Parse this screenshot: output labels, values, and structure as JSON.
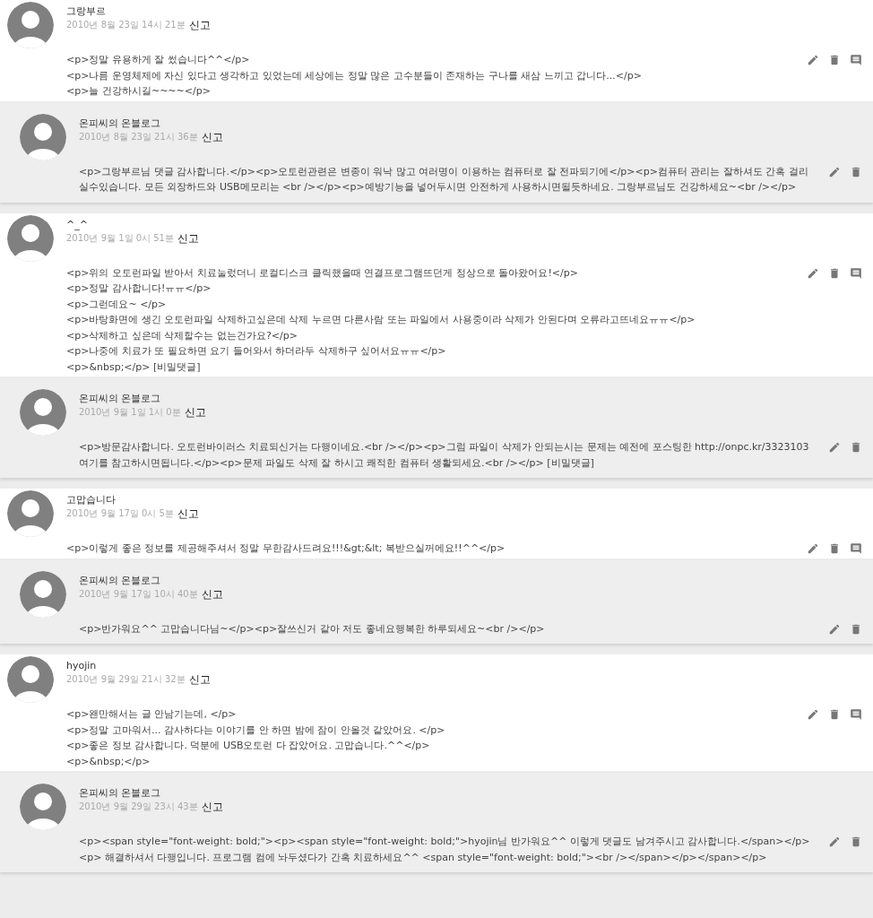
{
  "comments": [
    {
      "author": "그랑부르",
      "date": "2010년 8월 23일 14시 21분",
      "report": "신고",
      "lines": [
        "<p>정말 유용하게 잘 썼습니다^^</p>",
        "<p>나름 운영체제에 자신 있다고 생각하고 있었는데 세상에는 정말 많은 고수분들이 존재하는 구나를 새삼 느끼고 갑니다...</p>",
        "<p>늘 건강하시길~~~~</p>"
      ],
      "replies": [
        {
          "author": "온피씨의 온블로그",
          "date": "2010년 8월 23일 21시 36분",
          "report": "신고",
          "text": "<p>그랑부르님 댓글 감사합니다.</p><p>오토런관련은 변종이 워낙 많고 여러명이 이용하는 컴퓨터로 잘 전파되기에</p><p>컴퓨터 관리는 잘하셔도 간혹 걸리실수있습니다. 모든 외장하드와 USB메모리는 <br /></p><p>예방기능을 넣어두시면 안전하게 사용하시면될듯하네요. 그랑부르님도 건강하세요~<br /></p>"
        }
      ]
    },
    {
      "author": "^_^",
      "date": "2010년 9월 1일 0시 51분",
      "report": "신고",
      "lines": [
        "<p>위의 오토런파일 받아서 치료눌렀더니 로컬디스크 클릭했을때 연결프로그램뜨던게 정상으로 돌아왔어요!</p>",
        "<p>정말 감사합니다!ㅠㅠ</p>",
        "<p>그런데요~ </p>",
        "<p>바탕화면에 생긴 오토런파일 삭제하고싶은데 삭제 누르면 다른사람 또는 파일에서 사용중이라 삭제가 안된다며 오류라고뜨네요ㅠㅠ</p>",
        "<p>삭제하고 싶은데 삭제할수는 없는건가요?</p>",
        "<p>나중에 치료가 또 필요하면 요기 들어와서 하더라두 삭제하구 싶어서요ㅠㅠ</p>",
        "<p>&nbsp;</p> [비밀댓글]"
      ],
      "replies": [
        {
          "author": "온피씨의 온블로그",
          "date": "2010년 9월 1일 1시 0분",
          "report": "신고",
          "text": "<p>방문감사합니다. 오토런바이러스 치료되신거는 다행이네요.<br /></p><p>그럼 파일이 삭제가 안되는시는 문제는 예전에 포스팅한 http://onpc.kr/3323103 여기를 참고하시면됩니다.</p><p>문제 파일도 삭제 잘 하시고 쾌적한 컴퓨터 생활되세요.<br /></p> [비밀댓글]"
        }
      ]
    },
    {
      "author": "고맙습니다",
      "date": "2010년 9월 17일 0시 5분",
      "report": "신고",
      "lines": [
        "<p>이렇게 좋은 정보를 제공해주셔서 정말 무한감사드려요!!!&gt;&lt; 복받으실꺼에요!!^^</p>"
      ],
      "replies": [
        {
          "author": "온피씨의 온블로그",
          "date": "2010년 9월 17일 10시 40분",
          "report": "신고",
          "text": "<p>반가워요^^ 고맙습니다님~</p><p>잘쓰신거 같아 저도 좋네요행복한 하루되세요~<br /></p>"
        }
      ]
    },
    {
      "author": "hyojin",
      "date": "2010년 9월 29일 21시 32분",
      "report": "신고",
      "lines": [
        "<p>왠만해서는 글 안남기는데, </p>",
        "<p>정말 고마워서... 감사하다는 이야기를 안 하면 밤에 잠이 안올것 같았어요. </p>",
        "<p>좋은 정보 감사합니다. 덕분에 USB오토런 다 잡았어요. 고맙습니다.^^</p>",
        "<p>&nbsp;</p>"
      ],
      "replies": [
        {
          "author": "온피씨의 온블로그",
          "date": "2010년 9월 29일 23시 43분",
          "report": "신고",
          "text": "<p><span style=\"font-weight: bold;\"><p><span style=\"font-weight: bold;\">hyojin님 반가워요^^ 이렇게 댓글도 남겨주시고 감사합니다.</span></p><p> 해결하셔서 다행입니다. 프로그램 컴에 놔두셨다가 간혹 치료하세요^^ <span style=\"font-weight: bold;\"><br /></span></p></span></p>"
        }
      ]
    }
  ]
}
